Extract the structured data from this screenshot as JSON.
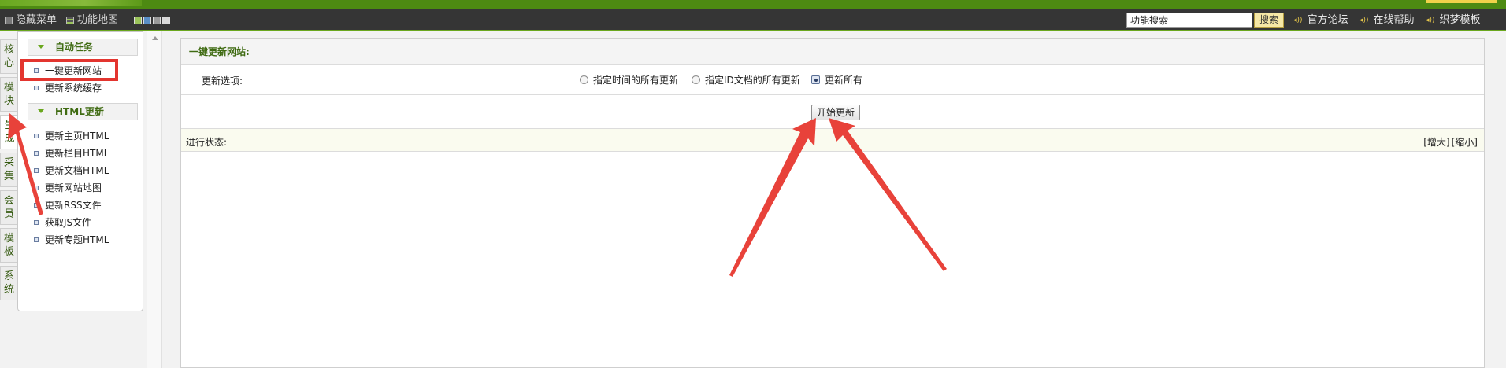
{
  "toolbar": {
    "hide_menu": "隐藏菜单",
    "site_map": "功能地图",
    "search_value": "功能搜索",
    "search_button": "搜索",
    "links": [
      "官方论坛",
      "在线帮助",
      "织梦模板"
    ]
  },
  "tabs": [
    {
      "line1": "核",
      "line2": "心"
    },
    {
      "line1": "模",
      "line2": "块"
    },
    {
      "line1": "生",
      "line2": "成"
    },
    {
      "line1": "采",
      "line2": "集"
    },
    {
      "line1": "会",
      "line2": "员"
    },
    {
      "line1": "模",
      "line2": "板"
    },
    {
      "line1": "系",
      "line2": "统"
    }
  ],
  "sidebar": {
    "section1": "自动任务",
    "section1_items": [
      "一键更新网站",
      "更新系统缓存"
    ],
    "section2": "HTML更新",
    "section2_items": [
      "更新主页HTML",
      "更新栏目HTML",
      "更新文档HTML",
      "更新网站地图",
      "更新RSS文件",
      "获取JS文件",
      "更新专题HTML"
    ]
  },
  "main": {
    "title": "一键更新网站:",
    "option_label": "更新选项:",
    "radios": [
      "指定时间的所有更新",
      "指定ID文档的所有更新",
      "更新所有"
    ],
    "selected_radio": "更新所有",
    "start_button": "开始更新",
    "status_label": "进行状态:",
    "enlarge": "[增大]",
    "shrink": "[缩小]"
  },
  "colors": {
    "accent_green": "#6aa71e",
    "toolbar_bg": "#353535",
    "highlight_red": "#e3352f"
  }
}
